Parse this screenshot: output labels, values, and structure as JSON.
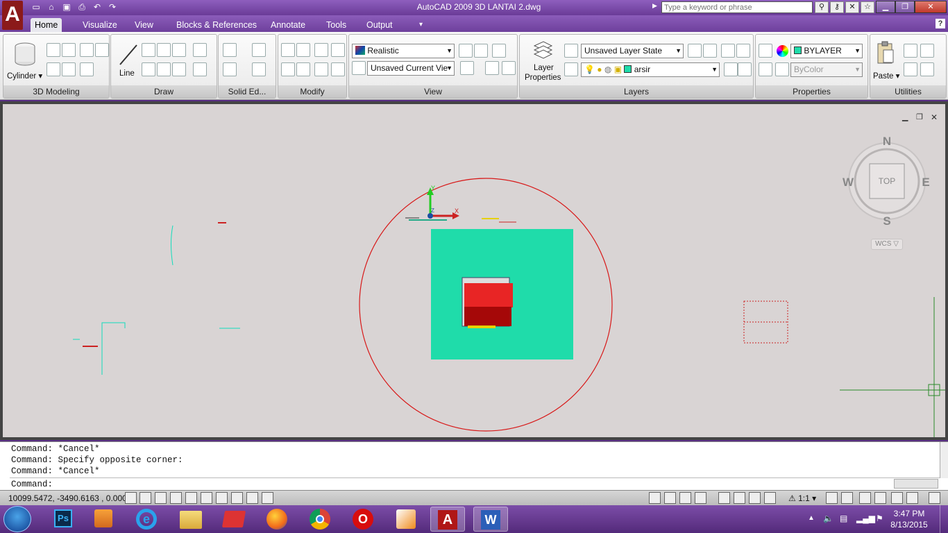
{
  "title_bar": {
    "app_logo": "A",
    "title": "AutoCAD 2009 3D LANTAI 2.dwg",
    "search_placeholder": "Type a keyword or phrase",
    "quick_access": [
      "new-icon",
      "open-icon",
      "save-icon",
      "plot-icon",
      "undo-icon",
      "redo-icon"
    ],
    "window_controls": [
      "minimize",
      "restore",
      "close"
    ]
  },
  "tabs": [
    {
      "label": "Home",
      "active": true
    },
    {
      "label": "Visualize"
    },
    {
      "label": "View"
    },
    {
      "label": "Blocks & References"
    },
    {
      "label": "Annotate"
    },
    {
      "label": "Tools"
    },
    {
      "label": "Output"
    }
  ],
  "help": "?",
  "ribbon": {
    "panels": {
      "modeling": "3D Modeling",
      "draw": "Draw",
      "solid_editing": "Solid Ed...",
      "modify": "Modify",
      "view": "View",
      "layers": "Layers",
      "properties": "Properties",
      "utilities": "Utilities"
    },
    "cylinder_label": "Cylinder",
    "line_label": "Line",
    "visual_style": "Realistic",
    "named_view": "Unsaved Current Vie",
    "layer_properties_label1": "Layer",
    "layer_properties_label2": "Properties",
    "layer_state": "Unsaved Layer State",
    "current_layer": "arsir",
    "color": "BYLAYER",
    "plot_style": "ByColor",
    "paste_label": "Paste"
  },
  "viewcube": {
    "face": "TOP",
    "north": "N",
    "south": "S",
    "east": "E",
    "west": "W",
    "ucs": "WCS"
  },
  "ucs_icon": {
    "y": "Y",
    "x": "X",
    "z": "Z"
  },
  "command": {
    "history": [
      "Command: *Cancel*",
      "Command: Specify opposite corner:",
      "Command: *Cancel*"
    ],
    "prompt": "Command:"
  },
  "status": {
    "coordinates": "10099.5472, -3490.6163 , 0.0000",
    "annotation_scale": "1:1"
  },
  "taskbar": {
    "apps": [
      "windows-explorer",
      "photoshop",
      "media-player",
      "internet-explorer",
      "file-explorer",
      "book-app",
      "firefox",
      "chrome",
      "opera",
      "app-orange",
      "autocad",
      "word"
    ],
    "ps_label": "Ps",
    "word_label": "W",
    "opera_label": "O",
    "time": "3:47 PM",
    "date": "8/13/2015"
  },
  "colors": {
    "title_bar": "#7a4aa8",
    "canvas": "#d9d4d4",
    "slab": "#1fdcaa",
    "red_box": "#e82525",
    "circle": "#d81818"
  }
}
